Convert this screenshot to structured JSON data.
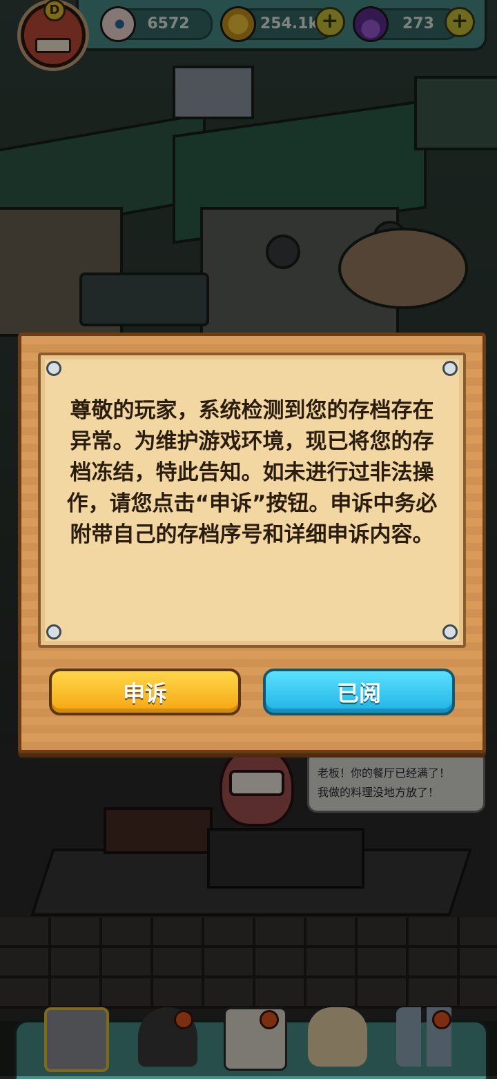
{
  "resources": {
    "eyes": {
      "icon": "eyeball-icon",
      "value": "6572"
    },
    "coins": {
      "icon": "coin-icon",
      "value": "254.1k",
      "add_icon": "plus-icon"
    },
    "potions": {
      "icon": "potion-icon",
      "value": "273",
      "add_icon": "plus-icon"
    }
  },
  "avatar": {
    "grade": "D"
  },
  "dialog": {
    "message": "尊敬的玩家，系统检测到您的存档存在异常。为维护游戏环境，现已将您的存档冻结，特此告知。如未进行过非法操作，请您点击“申诉”按钮。申诉中务必附带自己的存档序号和详细申诉内容。",
    "appeal_label": "申诉",
    "read_label": "已阅"
  },
  "speech_bubble": {
    "line1": "老板！你的餐厅已经满了！",
    "line2": "我做的料理没地方放了！"
  },
  "colors": {
    "appeal": "#f5a612",
    "read": "#1fb3e4",
    "dialog_wood": "#d79855",
    "paper": "#f2d7a2"
  }
}
